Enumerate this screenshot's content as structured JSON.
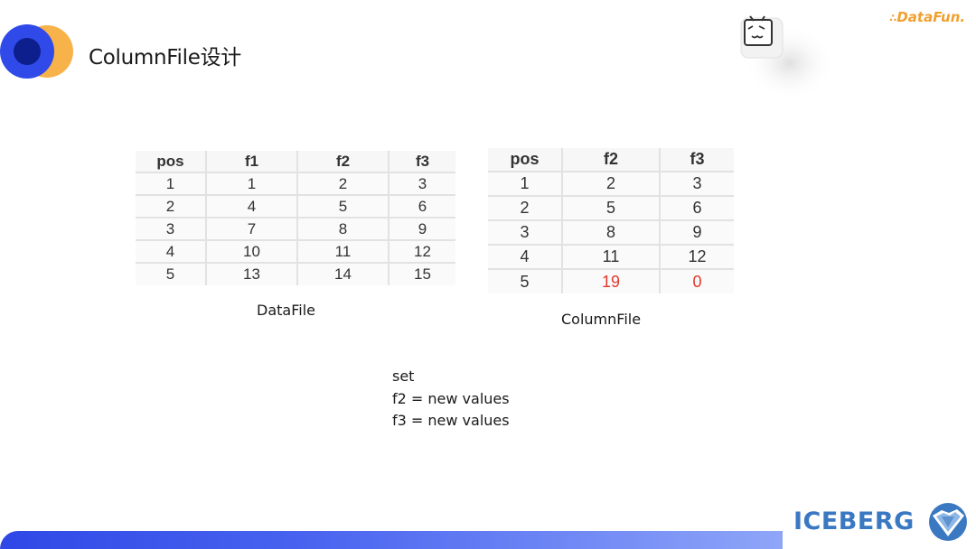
{
  "header": {
    "title": "ColumnFile设计"
  },
  "brand": {
    "name": "DataFun.",
    "dots": "∴"
  },
  "datafile": {
    "columns": [
      "pos",
      "f1",
      "f2",
      "f3"
    ],
    "rows": [
      [
        "1",
        "1",
        "2",
        "3"
      ],
      [
        "2",
        "4",
        "5",
        "6"
      ],
      [
        "3",
        "7",
        "8",
        "9"
      ],
      [
        "4",
        "10",
        "11",
        "12"
      ],
      [
        "5",
        "13",
        "14",
        "15"
      ]
    ],
    "caption": "DataFile"
  },
  "columnfile": {
    "columns": [
      "pos",
      "f2",
      "f3"
    ],
    "rows": [
      [
        "1",
        "2",
        "3"
      ],
      [
        "2",
        "5",
        "6"
      ],
      [
        "3",
        "8",
        "9"
      ],
      [
        "4",
        "11",
        "12"
      ],
      [
        "5",
        "19",
        "0"
      ]
    ],
    "caption": "ColumnFile",
    "highlight_color": "#e03a2f"
  },
  "update": {
    "line1": "set",
    "line2": "f2 = new values",
    "line3": "f3 = new values"
  },
  "footer": {
    "logo_text": "ICEBERG"
  }
}
